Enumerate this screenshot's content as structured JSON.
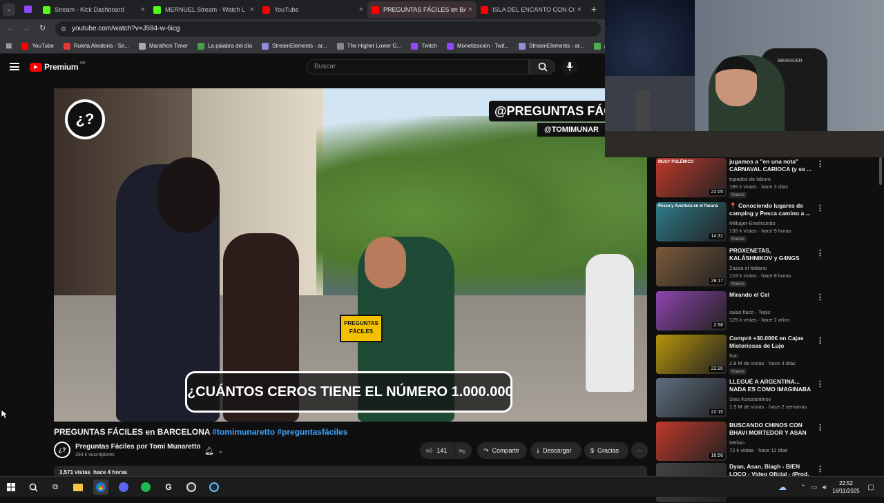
{
  "browser": {
    "tabs": [
      {
        "title": "Stream - Kick Dashboard",
        "color": "#53fc18"
      },
      {
        "title": "MERNUEL Stream - Watch L",
        "color": "#53fc18"
      },
      {
        "title": "YouTube",
        "color": "#ff0000"
      },
      {
        "title": "PREGUNTAS FÁCILES en BA",
        "color": "#ff0000"
      },
      {
        "title": "ISLA DEL ENCANTO CON COS",
        "color": "#ff0000"
      }
    ],
    "active_tab": 3,
    "url": "youtube.com/watch?v=J594-w-6icg",
    "bookmarks": [
      {
        "label": "YouTube",
        "color": "#ff0000"
      },
      {
        "label": "Ruleta Aleatoria - Se...",
        "color": "#e53935"
      },
      {
        "label": "Marathon Timer",
        "color": "#aaaaaa"
      },
      {
        "label": "La palabra del día",
        "color": "#43a047"
      },
      {
        "label": "StreamElements - ar...",
        "color": "#8e8ed8"
      },
      {
        "label": "The Higher Lower G...",
        "color": "#888888"
      },
      {
        "label": "Twitch",
        "color": "#9146ff"
      },
      {
        "label": "Monetización - Twit...",
        "color": "#9146ff"
      },
      {
        "label": "StreamElements - ar...",
        "color": "#8e8ed8"
      },
      {
        "label": "Adivina el",
        "color": "#4caf50"
      }
    ]
  },
  "youtube": {
    "logo_text": "Premium",
    "region": "AR",
    "search_placeholder": "Buscar"
  },
  "video": {
    "overlay_handle": "@PREGUNTAS FÁC",
    "overlay_sub": "@TOMIMUNAR",
    "logo_mark": "¿?",
    "caption": "¿CUÁNTOS CEROS TIENE EL NÚMERO 1.000.000?",
    "mic_label": "PREGUNTAS FÁCILES",
    "title": "PREGUNTAS FÁCILES en BARCELONA",
    "title_tags": "#tomimunaretto #preguntasfáciles",
    "channel": "Preguntas Fáciles por Tomi Munaretto",
    "subscribers": "334 k suscriptores",
    "likes": "141",
    "share": "Compartir",
    "download": "Descargar",
    "thanks": "Gracias",
    "views": "3,571 vistas",
    "age": "hace 4 horas"
  },
  "recommendations": [
    {
      "title": "jugamos a \"en una nota\" CARNAVAL CARIOCA (y se ...",
      "channel": "topados de laburo",
      "meta": "195 k vistas · hace 2 días",
      "badge": "Nuevo",
      "duration": "22:05",
      "thumb_text": "MUUY POLÉMICO",
      "thumb_color": "#c0392b"
    },
    {
      "title": "📍 Conociendo lugares de camping y Pesca camino a ...",
      "channel": "Milluger-Enelmundo",
      "meta": "135 k vistas · hace 5 horas",
      "badge": "Nuevo",
      "duration": "14:31",
      "thumb_text": "Pesca y Aventura en el Paraná",
      "thumb_color": "#2e7d8a"
    },
    {
      "title": "PROXENETAS, KALÁSHNIKOV y G4NGS NIGERIANAS ZA",
      "channel": "Zazza el italiano",
      "meta": "124 k vistas · hace 8 horas",
      "badge": "Nuevo",
      "duration": "29:17",
      "thumb_text": "",
      "thumb_color": "#7a5a3a"
    },
    {
      "title": "Mirando el Cel",
      "channel": "salas flaco - Topic",
      "meta": "125 k vistas · hace 2 años",
      "badge": "",
      "duration": "2:58",
      "thumb_text": "",
      "thumb_color": "#8e44ad"
    },
    {
      "title": "Compré +30.000€ en Cajas Misteriosas de Lujo",
      "channel": "Ibai",
      "meta": "2.8 M de vistas · hace 3 días",
      "badge": "Nuevo",
      "duration": "22:20",
      "thumb_text": "",
      "thumb_color": "#b7950b"
    },
    {
      "title": "LLEGUÉ A ARGENTINA... NADA ES COMO IMAGINABA",
      "channel": "Stes Konstantinov",
      "meta": "1.5 M de vistas · hace 2 semanas",
      "badge": "",
      "duration": "22:15",
      "thumb_text": "",
      "thumb_color": "#5d6d7e"
    },
    {
      "title": "BUSCANDO CHINOS CON BHAVI MORTEDOR Y ASAN e...",
      "channel": "Melian",
      "meta": "72 k vistas · hace 11 días",
      "badge": "",
      "duration": "16:56",
      "thumb_text": "",
      "thumb_color": "#c0392b"
    },
    {
      "title": "Dyan, Asan, Blagh - BIEN LOCO - Video Oficial - (Prod. AWP)",
      "channel": "",
      "meta": "",
      "badge": "",
      "duration": "",
      "thumb_text": "",
      "thumb_color": "#444444"
    }
  ],
  "webcam": {
    "chair_brand": "WERACER"
  },
  "taskbar": {
    "time": "22:52",
    "date": "16/11/2025"
  }
}
